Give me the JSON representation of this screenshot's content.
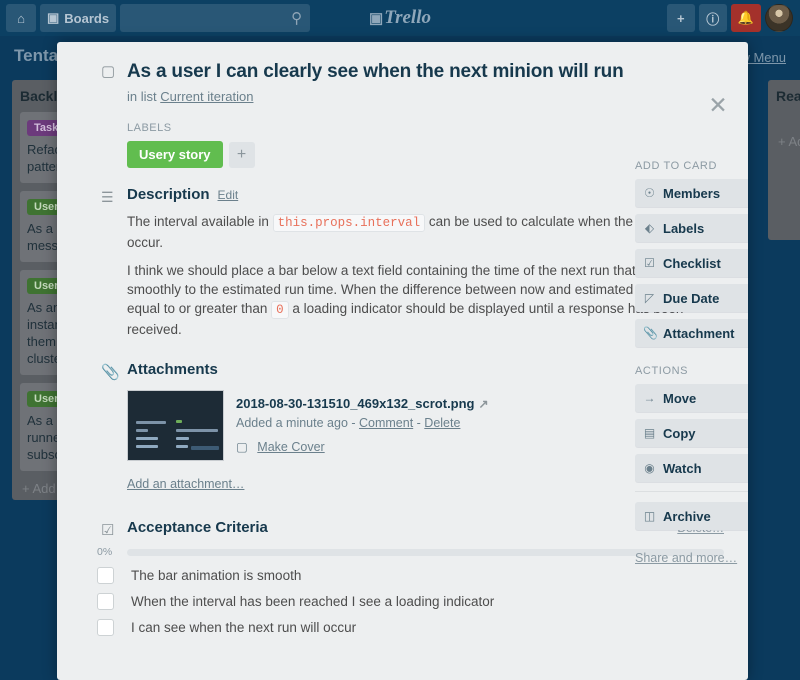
{
  "topbar": {
    "home_icon": "home-icon",
    "boards_label": "Boards",
    "search_placeholder": "",
    "search_icon": "search-icon",
    "logo_text": "Trello",
    "add_icon": "plus-icon",
    "info_icon": "info-icon",
    "notification_icon": "bell-icon",
    "avatar": "user-avatar",
    "bell_color": "#a4312b"
  },
  "board": {
    "title": "Tenta",
    "show_menu": "w Menu",
    "lists": [
      {
        "title": "Backl",
        "add_label": "+ Add a",
        "cards": [
          {
            "label": "Task",
            "label_color": "purple",
            "text": "Refact\npatterr"
          },
          {
            "label": "Usery",
            "label_color": "green",
            "text": "As a us\nmessa"
          },
          {
            "label": "Usery",
            "label_color": "green",
            "text": "As an \ninstanc\nthem a\ncluster"
          },
          {
            "label": "Usery",
            "label_color": "green",
            "text": "As a us\nrunner\nsubscr"
          }
        ]
      },
      {
        "title": "Read",
        "add_label": "+ Ad",
        "cards": []
      }
    ]
  },
  "card": {
    "close_icon": "close-icon",
    "title_icon": "card-icon",
    "title": "As a user I can clearly see when the next minion will run",
    "in_list_prefix": "in list",
    "list_name": "Current iteration",
    "labels_heading": "LABELS",
    "labels": [
      {
        "text": "Usery story",
        "color": "#61bd4f"
      }
    ],
    "label_add_icon": "plus-icon",
    "description": {
      "icon": "description-icon",
      "heading": "Description",
      "edit_label": "Edit",
      "paragraphs": [
        {
          "before": "The interval available in ",
          "code": "this.props.interval",
          "after": " can be used to calculate when the next run will occur."
        },
        {
          "before": "I think we should place a bar below a text field containing the time of the next run that animates smoothly to the estimated run time. When the difference between now and estimated run time is equal to or greater than ",
          "code": "0",
          "after": " a loading indicator should be displayed until a response has been received."
        }
      ]
    },
    "attachments": {
      "icon": "paperclip-icon",
      "heading": "Attachments",
      "items": [
        {
          "name": "2018-08-30-131510_469x132_scrot.png",
          "open_icon": "external-link-icon",
          "added": "Added a minute ago",
          "comment_label": "Comment",
          "delete_label": "Delete",
          "make_cover_icon": "cover-icon",
          "make_cover_label": "Make Cover",
          "thumbnail": "terminal-screenshot"
        }
      ],
      "add_label": "Add an attachment…"
    },
    "checklist": {
      "icon": "checklist-icon",
      "heading": "Acceptance Criteria",
      "delete_label": "Delete…",
      "percent_label": "0%",
      "percent_value": 0,
      "items": [
        {
          "text": "The bar animation is smooth",
          "checked": false
        },
        {
          "text": "When the interval has been reached I see a loading indicator",
          "checked": false
        },
        {
          "text": "I can see when the next run will occur",
          "checked": false
        }
      ]
    }
  },
  "sidebar": {
    "add_heading": "ADD TO CARD",
    "add_items": [
      {
        "label": "Members",
        "icon": "person-icon",
        "glyph": "⛉"
      },
      {
        "label": "Labels",
        "icon": "tag-icon",
        "glyph": "⬖"
      },
      {
        "label": "Checklist",
        "icon": "checklist-icon",
        "glyph": "☑"
      },
      {
        "label": "Due Date",
        "icon": "clock-icon",
        "glyph": "◴"
      },
      {
        "label": "Attachment",
        "icon": "paperclip-icon",
        "glyph": "⌇"
      }
    ],
    "actions_heading": "ACTIONS",
    "action_items": [
      {
        "label": "Move",
        "icon": "arrow-right-icon",
        "glyph": "→"
      },
      {
        "label": "Copy",
        "icon": "copy-icon",
        "glyph": "▤"
      },
      {
        "label": "Watch",
        "icon": "eye-icon",
        "glyph": "◉"
      }
    ],
    "archive": {
      "label": "Archive",
      "icon": "archive-icon",
      "glyph": "☐"
    },
    "share_label": "Share and more…"
  }
}
